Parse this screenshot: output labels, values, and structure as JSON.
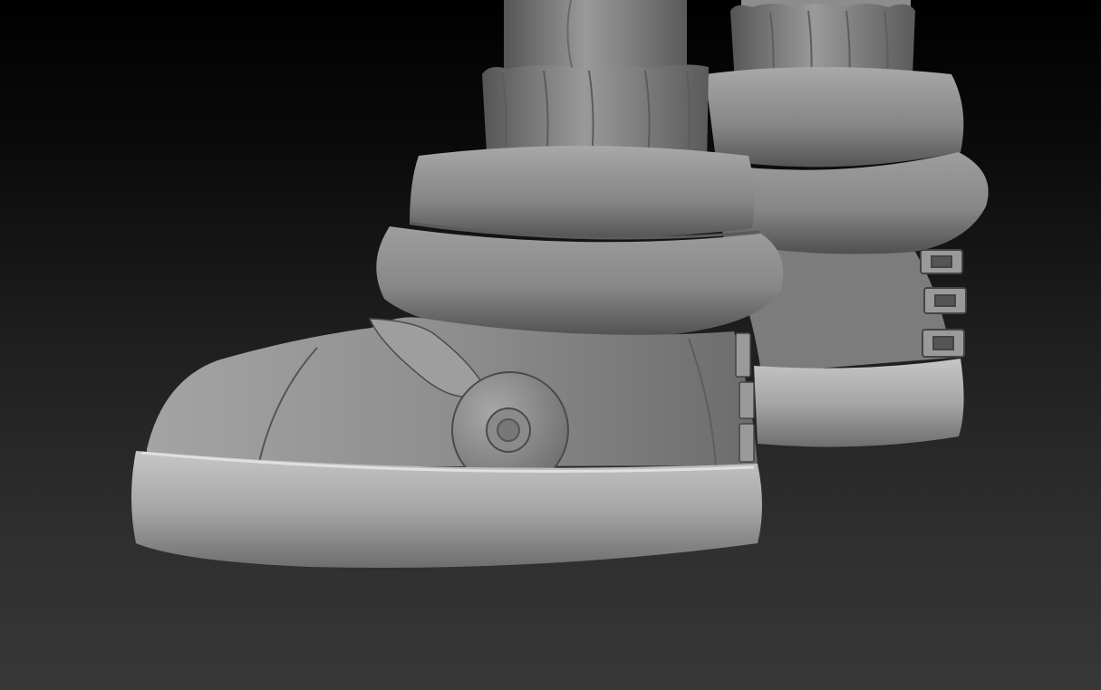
{
  "viewport": {
    "background_top": "#000000",
    "background_bottom": "#373737"
  },
  "model": {
    "material_color": "#8a8a8a",
    "highlight_color": "#c4c4c4",
    "shadow_color": "#3a3a3a"
  },
  "icons": {
    "front_boot": "boot-icon",
    "back_boot": "boot-icon"
  }
}
